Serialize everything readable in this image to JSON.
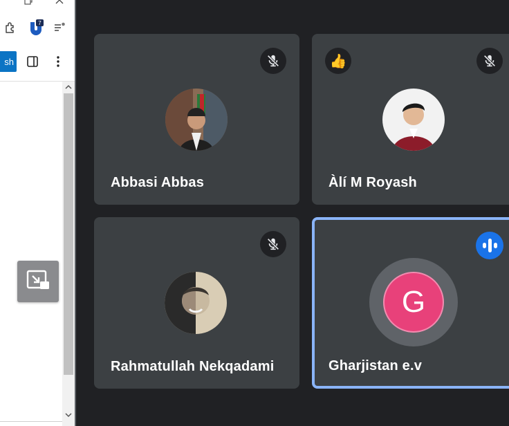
{
  "browser": {
    "extension_badge": "7",
    "publish_label": "sh"
  },
  "participants": [
    {
      "name": "Abbasi Abbas",
      "muted": true
    },
    {
      "name": "Àlí M Royash",
      "muted": true,
      "reaction": "👍"
    },
    {
      "name": "Rahmatullah Nekqadami",
      "muted": true
    },
    {
      "name": "Gharjistan e.v",
      "muted": false,
      "speaking": true,
      "initial": "G"
    }
  ],
  "colors": {
    "tile": "#3c4043",
    "background": "#202124",
    "active_border": "#8ab4f8",
    "speaking": "#1a73e8",
    "avatar_g": "#e8417a"
  },
  "icons": {
    "mute": "mic-off-icon",
    "speaking": "audio-level-icon",
    "pip": "picture-in-picture-icon"
  }
}
